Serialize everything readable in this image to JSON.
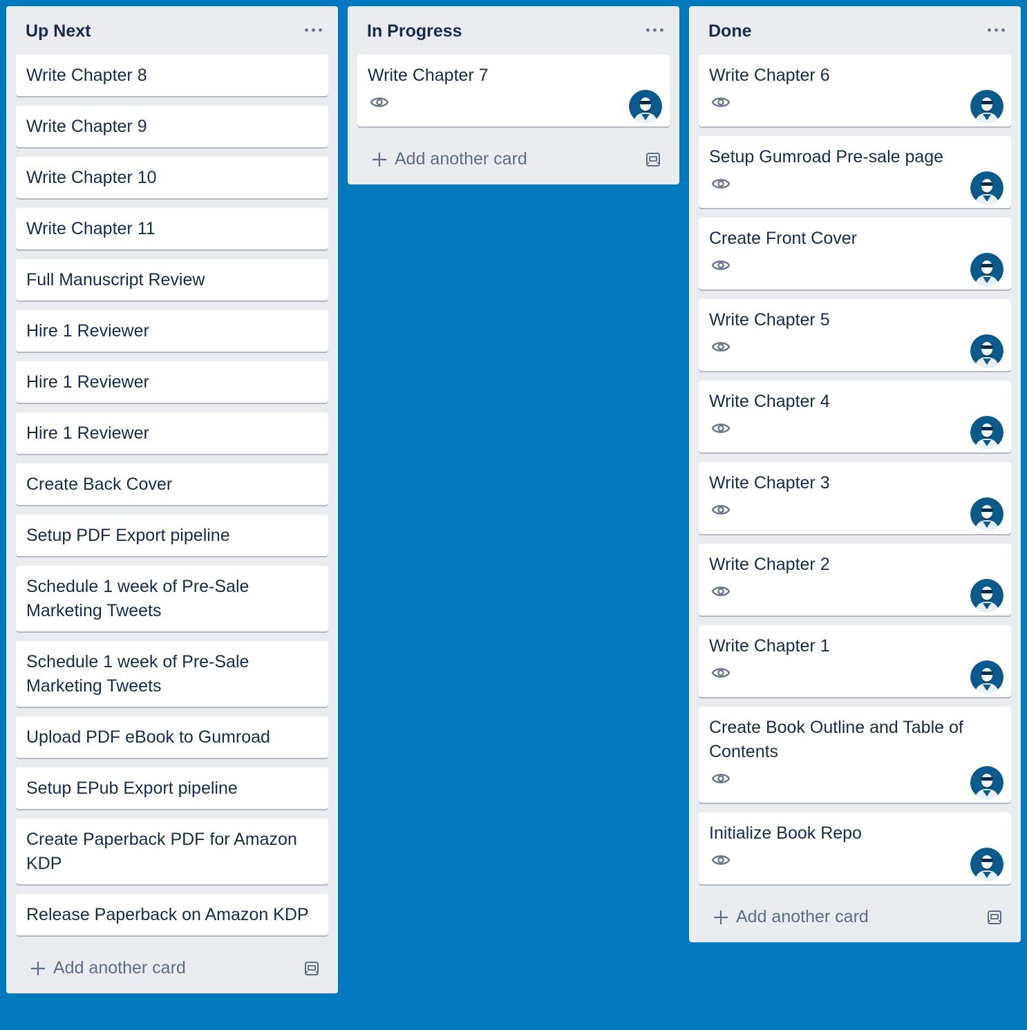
{
  "colors": {
    "board_background": "#0079bf",
    "list_background": "#ebecf0",
    "card_background": "#ffffff",
    "text_primary": "#172b4d",
    "text_secondary": "#5e6c84",
    "avatar_background": "#0a5a8c"
  },
  "icons": {
    "list_menu": "more-horizontal-icon",
    "watch": "eye-icon",
    "add": "plus-icon",
    "template": "card-template-icon",
    "member": "avatar"
  },
  "add_card_label": "Add another card",
  "lists": [
    {
      "title": "Up Next",
      "cards": [
        {
          "title": "Write Chapter 8"
        },
        {
          "title": "Write Chapter 9"
        },
        {
          "title": "Write Chapter 10"
        },
        {
          "title": "Write Chapter 11"
        },
        {
          "title": "Full Manuscript Review"
        },
        {
          "title": "Hire 1 Reviewer"
        },
        {
          "title": "Hire 1 Reviewer"
        },
        {
          "title": "Hire 1 Reviewer"
        },
        {
          "title": "Create Back Cover"
        },
        {
          "title": "Setup PDF Export pipeline"
        },
        {
          "title": "Schedule 1 week of Pre-Sale Marketing Tweets"
        },
        {
          "title": "Schedule 1 week of Pre-Sale Marketing Tweets"
        },
        {
          "title": "Upload PDF eBook to Gumroad"
        },
        {
          "title": "Setup EPub Export pipeline"
        },
        {
          "title": "Create Paperback PDF for Amazon KDP"
        },
        {
          "title": "Release Paperback on Amazon KDP"
        }
      ]
    },
    {
      "title": "In Progress",
      "cards": [
        {
          "title": "Write Chapter 7",
          "watched": true,
          "has_member": true
        }
      ]
    },
    {
      "title": "Done",
      "cards": [
        {
          "title": "Write Chapter 6",
          "watched": true,
          "has_member": true
        },
        {
          "title": "Setup Gumroad Pre-sale page",
          "watched": true,
          "has_member": true
        },
        {
          "title": "Create Front Cover",
          "watched": true,
          "has_member": true
        },
        {
          "title": "Write Chapter 5",
          "watched": true,
          "has_member": true
        },
        {
          "title": "Write Chapter 4",
          "watched": true,
          "has_member": true
        },
        {
          "title": "Write Chapter 3",
          "watched": true,
          "has_member": true
        },
        {
          "title": "Write Chapter 2",
          "watched": true,
          "has_member": true
        },
        {
          "title": "Write Chapter 1",
          "watched": true,
          "has_member": true
        },
        {
          "title": "Create Book Outline and Table of Contents",
          "watched": true,
          "has_member": true
        },
        {
          "title": "Initialize Book Repo",
          "watched": true,
          "has_member": true
        }
      ]
    }
  ]
}
